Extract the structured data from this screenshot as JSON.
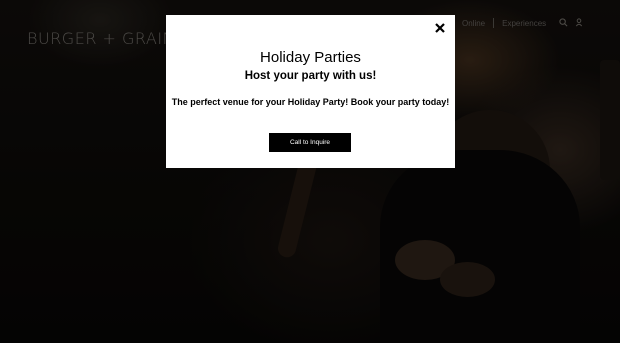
{
  "header": {
    "logo_text": "BURGER + GRAIN",
    "nav": [
      {
        "label": "Online"
      },
      {
        "label": "Experiences"
      }
    ],
    "icons": [
      "search-icon",
      "user-icon"
    ]
  },
  "modal": {
    "title": "Holiday Parties",
    "subtitle": "Host your party with us!",
    "body": "The perfect venue for your Holiday Party! Book your party today!",
    "cta_label": "Call to Inquire",
    "close_icon": "close-icon"
  }
}
